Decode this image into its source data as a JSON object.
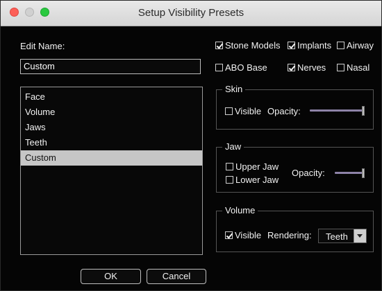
{
  "window": {
    "title": "Setup Visibility Presets"
  },
  "edit": {
    "label": "Edit Name:",
    "value": "Custom"
  },
  "presets": [
    "Face",
    "Volume",
    "Jaws",
    "Teeth",
    "Custom"
  ],
  "selected_preset": "Custom",
  "buttons": {
    "ok": "OK",
    "cancel": "Cancel"
  },
  "visibility": {
    "stone_models": {
      "label": "Stone Models",
      "checked": true
    },
    "implants": {
      "label": "Implants",
      "checked": true
    },
    "airway": {
      "label": "Airway",
      "checked": false
    },
    "abo_base": {
      "label": "ABO Base",
      "checked": false
    },
    "nerves": {
      "label": "Nerves",
      "checked": true
    },
    "nasal": {
      "label": "Nasal",
      "checked": false
    }
  },
  "skin": {
    "title": "Skin",
    "visible": {
      "label": "Visible",
      "checked": false
    },
    "opacity_label": "Opacity:",
    "opacity": 1.0
  },
  "jaw": {
    "title": "Jaw",
    "upper": {
      "label": "Upper Jaw",
      "checked": false
    },
    "lower": {
      "label": "Lower Jaw",
      "checked": false
    },
    "opacity_label": "Opacity:",
    "opacity": 1.0
  },
  "volume": {
    "title": "Volume",
    "visible": {
      "label": "Visible",
      "checked": true
    },
    "rendering_label": "Rendering:",
    "rendering_value": "Teeth"
  },
  "colors": {
    "accent_track": "#8e83a8",
    "close": "#fc5f57",
    "maximize": "#2ac940"
  }
}
